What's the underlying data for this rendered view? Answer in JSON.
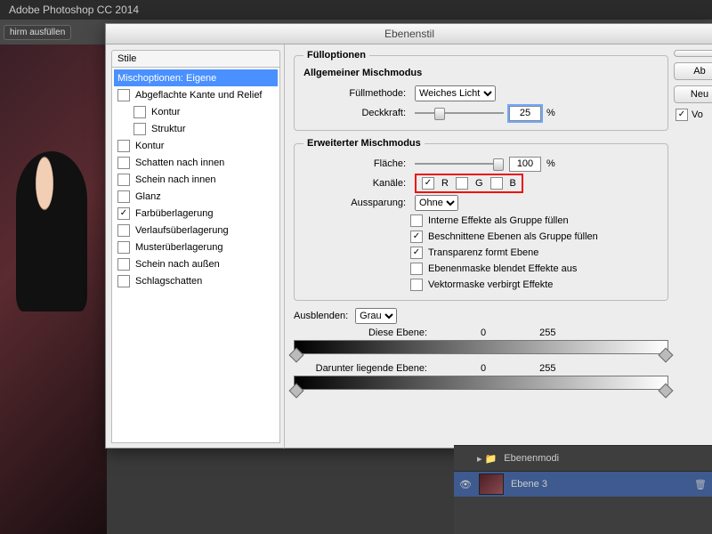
{
  "app": {
    "title": "Adobe Photoshop CC 2014"
  },
  "toolbar": {
    "fill_screen": "hirm ausfüllen"
  },
  "dialog": {
    "title": "Ebenenstil",
    "styles_header": "Stile",
    "styles": [
      {
        "label": "Mischoptionen: Eigene",
        "selected": true,
        "checkbox": false
      },
      {
        "label": "Abgeflachte Kante und Relief",
        "checked": false,
        "checkbox": true
      },
      {
        "label": "Kontur",
        "checked": false,
        "checkbox": true,
        "sub": true
      },
      {
        "label": "Struktur",
        "checked": false,
        "checkbox": true,
        "sub": true
      },
      {
        "label": "Kontur",
        "checked": false,
        "checkbox": true
      },
      {
        "label": "Schatten nach innen",
        "checked": false,
        "checkbox": true
      },
      {
        "label": "Schein nach innen",
        "checked": false,
        "checkbox": true
      },
      {
        "label": "Glanz",
        "checked": false,
        "checkbox": true
      },
      {
        "label": "Farbüberlagerung",
        "checked": true,
        "checkbox": true
      },
      {
        "label": "Verlaufsüberlagerung",
        "checked": false,
        "checkbox": true
      },
      {
        "label": "Musterüberlagerung",
        "checked": false,
        "checkbox": true
      },
      {
        "label": "Schein nach außen",
        "checked": false,
        "checkbox": true
      },
      {
        "label": "Schlagschatten",
        "checked": false,
        "checkbox": true
      }
    ],
    "fill_options_title": "Fülloptionen",
    "general_blend": {
      "title": "Allgemeiner Mischmodus",
      "mode_label": "Füllmethode:",
      "mode_value": "Weiches Licht",
      "opacity_label": "Deckkraft:",
      "opacity_value": "25",
      "opacity_unit": "%"
    },
    "advanced_blend": {
      "title": "Erweiterter Mischmodus",
      "fill_label": "Fläche:",
      "fill_value": "100",
      "fill_unit": "%",
      "channels_label": "Kanäle:",
      "channel_r": "R",
      "channel_g": "G",
      "channel_b": "B",
      "channel_r_checked": true,
      "channel_g_checked": false,
      "channel_b_checked": false,
      "knockout_label": "Aussparung:",
      "knockout_value": "Ohne",
      "opt1": "Interne Effekte als Gruppe füllen",
      "opt2": "Beschnittene Ebenen als Gruppe füllen",
      "opt3": "Transparenz formt Ebene",
      "opt4": "Ebenenmaske blendet Effekte aus",
      "opt5": "Vektormaske verbirgt Effekte",
      "opt1_checked": false,
      "opt2_checked": true,
      "opt3_checked": true,
      "opt4_checked": false,
      "opt5_checked": false
    },
    "blend_if": {
      "label": "Ausblenden:",
      "value": "Grau",
      "this_label": "Diese Ebene:",
      "this_lo": "0",
      "this_hi": "255",
      "under_label": "Darunter liegende Ebene:",
      "under_lo": "0",
      "under_hi": "255"
    },
    "buttons": {
      "ok": "",
      "cancel": "Ab",
      "new_style": "Neu",
      "preview": "Vo"
    }
  },
  "layers": {
    "folder": "Ebenenmodi",
    "layer": "Ebene 3"
  }
}
